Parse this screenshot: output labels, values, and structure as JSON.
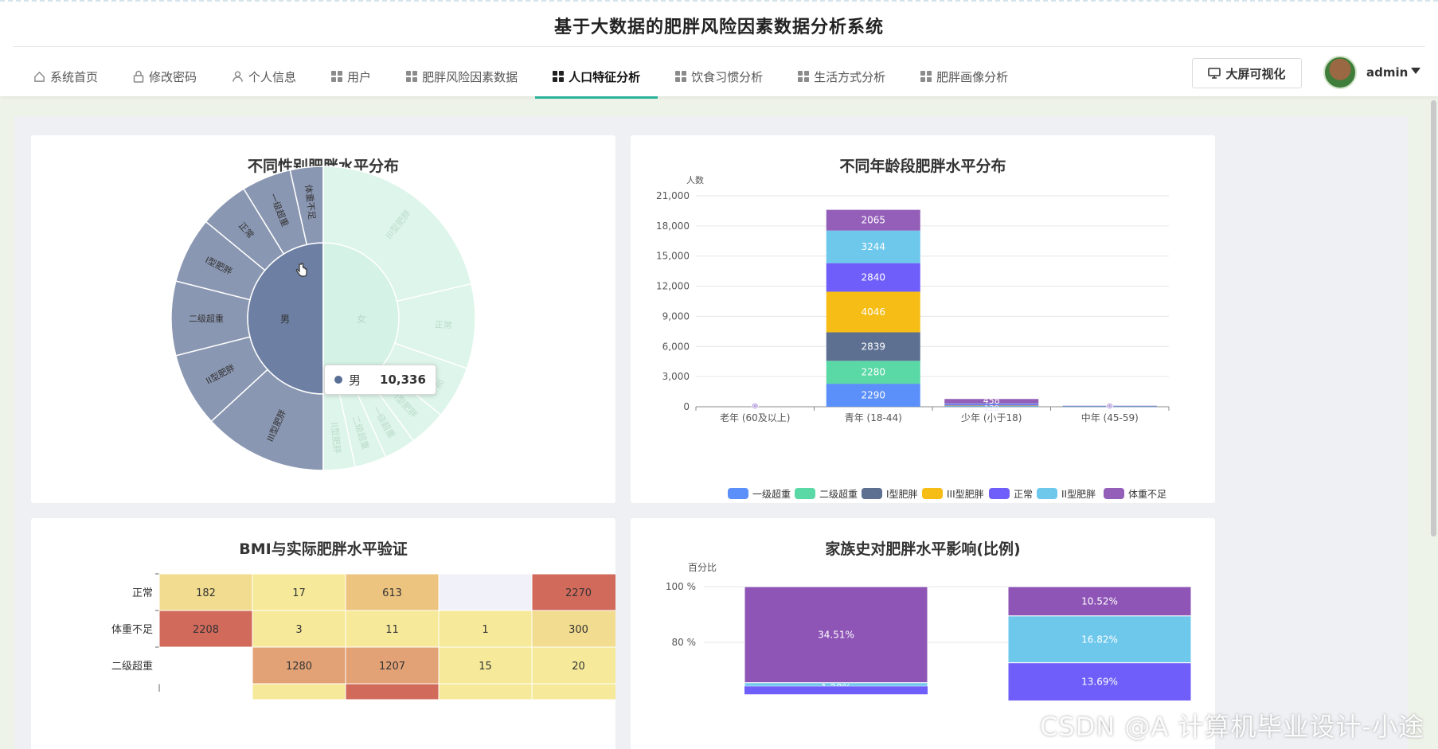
{
  "header": {
    "title": "基于大数据的肥胖风险因素数据分析系统",
    "nav": [
      {
        "label": "系统首页",
        "icon": "home-icon"
      },
      {
        "label": "修改密码",
        "icon": "lock-icon"
      },
      {
        "label": "个人信息",
        "icon": "user-icon"
      },
      {
        "label": "用户",
        "icon": "grid-icon"
      },
      {
        "label": "肥胖风险因素数据",
        "icon": "grid-icon"
      },
      {
        "label": "人口特征分析",
        "icon": "grid-icon",
        "active": true
      },
      {
        "label": "饮食习惯分析",
        "icon": "grid-icon"
      },
      {
        "label": "生活方式分析",
        "icon": "grid-icon"
      },
      {
        "label": "肥胖画像分析",
        "icon": "grid-icon"
      }
    ],
    "bigscreen_label": "大屏可视化",
    "username": "admin"
  },
  "colors": {
    "accent": "#2bb39a"
  },
  "gender_chart": {
    "title": "不同性别肥胖水平分布",
    "tooltip": {
      "label": "男",
      "value": "10,336"
    },
    "cursor": "hand-pointer-icon"
  },
  "age_chart": {
    "title": "不同年龄段肥胖水平分布",
    "ylabel": "人数"
  },
  "bmi_chart": {
    "title": "BMI与实际肥胖水平验证"
  },
  "family_chart": {
    "title": "家族史对肥胖水平影响(比例)",
    "ylabel": "百分比"
  },
  "watermark": "CSDN @A 计算机毕业设计-小途",
  "chart_data": [
    {
      "type": "sunburst",
      "title": "不同性别肥胖水平分布",
      "inner": [
        {
          "name": "男",
          "value": 10336
        },
        {
          "name": "女"
        }
      ],
      "outer_male": [
        "体重不足",
        "一级超重",
        "正常",
        "I型肥胖",
        "二级超重",
        "II型肥胖",
        "III型肥胖"
      ],
      "outer_female": [
        "III型肥胖",
        "正常",
        "体重不足",
        "I型肥胖",
        "一级超重",
        "二级超重",
        "II型肥胖"
      ],
      "male_weights": [
        4,
        6,
        6,
        9,
        10,
        17
      ],
      "female_weights": [
        38,
        14,
        8,
        6,
        5,
        4,
        4
      ]
    },
    {
      "type": "bar",
      "stacked": true,
      "title": "不同年龄段肥胖水平分布",
      "ylabel": "人数",
      "categories": [
        "老年 (60及以上)",
        "青年 (18-44)",
        "少年 (小于18)",
        "中年 (45-59)"
      ],
      "ylim": [
        0,
        21000
      ],
      "yticks": [
        "0",
        "3,000",
        "6,000",
        "9,000",
        "12,000",
        "15,000",
        "18,000",
        "21,000"
      ],
      "series": [
        {
          "name": "一级超重",
          "color": "#5b8ff9",
          "values": [
            0,
            2290,
            60,
            20
          ]
        },
        {
          "name": "二级超重",
          "color": "#5ad8a6",
          "values": [
            0,
            2280,
            30,
            40
          ]
        },
        {
          "name": "I型肥胖",
          "color": "#5d7092",
          "values": [
            0,
            2839,
            40,
            10
          ]
        },
        {
          "name": "III型肥胖",
          "color": "#f6bd16",
          "values": [
            0,
            4046,
            5,
            0
          ]
        },
        {
          "name": "正常",
          "color": "#6f5ef9",
          "values": [
            0,
            2840,
            120,
            10
          ]
        },
        {
          "name": "II型肥胖",
          "color": "#6dc8ec",
          "values": [
            0,
            3244,
            60,
            10
          ]
        },
        {
          "name": "体重不足",
          "color": "#945fb9",
          "values": [
            0,
            2065,
            458,
            5
          ]
        }
      ],
      "data_labels": {
        "少年 (小于18)": [
          "458",
          "120"
        ],
        "老年 (60及以上)": [
          "0"
        ],
        "中年 (45-59)": [
          "0"
        ]
      },
      "grid": true,
      "legend": "bottom",
      "datazoom": true
    },
    {
      "type": "heatmap",
      "title": "BMI与实际肥胖水平验证",
      "rows": [
        "正常",
        "体重不足",
        "二级超重"
      ],
      "values": [
        [
          182,
          17,
          613,
          null,
          2270
        ],
        [
          2208,
          3,
          11,
          1,
          300
        ],
        [
          null,
          1280,
          1207,
          15,
          20
        ]
      ]
    },
    {
      "type": "bar",
      "stacked": true,
      "title": "家族史对肥胖水平影响(比例)",
      "ylabel": "百分比",
      "yticks": [
        "80 %",
        "100 %"
      ],
      "bars": [
        {
          "segments": [
            {
              "label": "34.51%",
              "value": 34.51,
              "color": "#8e55b6"
            },
            {
              "label": "1.28%",
              "value": 1.28,
              "color": "#6dc8ec"
            }
          ]
        },
        {
          "segments": [
            {
              "label": "10.52%",
              "value": 10.52,
              "color": "#8e55b6"
            },
            {
              "label": "16.82%",
              "value": 16.82,
              "color": "#6dc8ec"
            },
            {
              "label": "13.69%",
              "value": 13.69,
              "color": "#6f5ef9"
            }
          ]
        }
      ]
    }
  ]
}
